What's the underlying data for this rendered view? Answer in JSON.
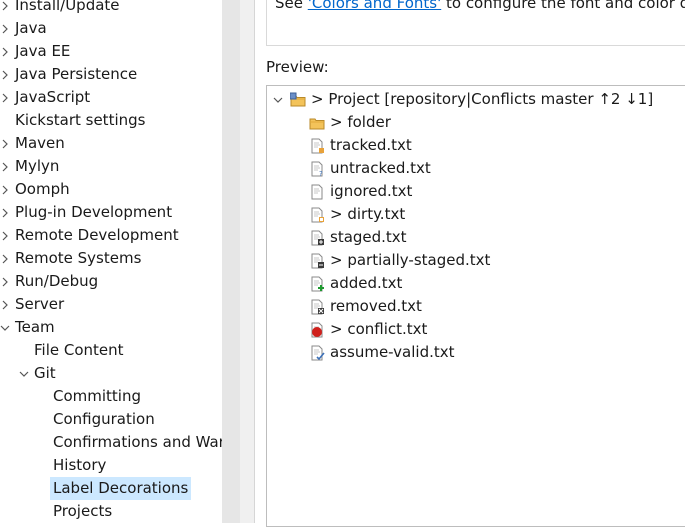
{
  "left_tree": {
    "items": [
      {
        "label": "Install/Update",
        "level": 0,
        "expander": "collapsed",
        "selected": false
      },
      {
        "label": "Java",
        "level": 0,
        "expander": "collapsed",
        "selected": false
      },
      {
        "label": "Java EE",
        "level": 0,
        "expander": "collapsed",
        "selected": false
      },
      {
        "label": "Java Persistence",
        "level": 0,
        "expander": "collapsed",
        "selected": false
      },
      {
        "label": "JavaScript",
        "level": 0,
        "expander": "collapsed",
        "selected": false
      },
      {
        "label": "Kickstart settings",
        "level": 0,
        "expander": "none",
        "selected": false
      },
      {
        "label": "Maven",
        "level": 0,
        "expander": "collapsed",
        "selected": false
      },
      {
        "label": "Mylyn",
        "level": 0,
        "expander": "collapsed",
        "selected": false
      },
      {
        "label": "Oomph",
        "level": 0,
        "expander": "collapsed",
        "selected": false
      },
      {
        "label": "Plug-in Development",
        "level": 0,
        "expander": "collapsed",
        "selected": false
      },
      {
        "label": "Remote Development",
        "level": 0,
        "expander": "collapsed",
        "selected": false
      },
      {
        "label": "Remote Systems",
        "level": 0,
        "expander": "collapsed",
        "selected": false
      },
      {
        "label": "Run/Debug",
        "level": 0,
        "expander": "collapsed",
        "selected": false
      },
      {
        "label": "Server",
        "level": 0,
        "expander": "collapsed",
        "selected": false
      },
      {
        "label": "Team",
        "level": 0,
        "expander": "expanded",
        "selected": false
      },
      {
        "label": "File Content",
        "level": 1,
        "expander": "none",
        "selected": false
      },
      {
        "label": "Git",
        "level": 1,
        "expander": "expanded",
        "selected": false
      },
      {
        "label": "Committing",
        "level": 2,
        "expander": "none",
        "selected": false
      },
      {
        "label": "Configuration",
        "level": 2,
        "expander": "none",
        "selected": false
      },
      {
        "label": "Confirmations and Warn",
        "level": 2,
        "expander": "none",
        "selected": false
      },
      {
        "label": "History",
        "level": 2,
        "expander": "none",
        "selected": false
      },
      {
        "label": "Label Decorations",
        "level": 2,
        "expander": "none",
        "selected": true
      },
      {
        "label": "Projects",
        "level": 2,
        "expander": "none",
        "selected": false
      }
    ]
  },
  "info": {
    "prefix": "See ",
    "link": "'Colors and Fonts'",
    "suffix": " to configure the font and color de"
  },
  "preview": {
    "label": "Preview:",
    "items": [
      {
        "name": "project",
        "text": "> Project  [repository|Conflicts master ↑2 ↓1]",
        "level": 0,
        "icon": "project-folder-icon",
        "expander": "expanded"
      },
      {
        "name": "folder",
        "text": "> folder",
        "level": 1,
        "icon": "folder-icon",
        "expander": "none"
      },
      {
        "name": "tracked",
        "text": "tracked.txt",
        "level": 1,
        "icon": "file-tracked-icon",
        "expander": "none"
      },
      {
        "name": "untracked",
        "text": "untracked.txt",
        "level": 1,
        "icon": "file-untracked-icon",
        "expander": "none"
      },
      {
        "name": "ignored",
        "text": "ignored.txt",
        "level": 1,
        "icon": "file-ignored-icon",
        "expander": "none"
      },
      {
        "name": "dirty",
        "text": "> dirty.txt",
        "level": 1,
        "icon": "file-dirty-icon",
        "expander": "none"
      },
      {
        "name": "staged",
        "text": "staged.txt",
        "level": 1,
        "icon": "file-staged-icon",
        "expander": "none"
      },
      {
        "name": "partially-staged",
        "text": "> partially-staged.txt",
        "level": 1,
        "icon": "file-partially-staged-icon",
        "expander": "none"
      },
      {
        "name": "added",
        "text": "added.txt",
        "level": 1,
        "icon": "file-added-icon",
        "expander": "none"
      },
      {
        "name": "removed",
        "text": "removed.txt",
        "level": 1,
        "icon": "file-removed-icon",
        "expander": "none"
      },
      {
        "name": "conflict",
        "text": "> conflict.txt",
        "level": 1,
        "icon": "file-conflict-icon",
        "expander": "none"
      },
      {
        "name": "assume-valid",
        "text": "assume-valid.txt",
        "level": 1,
        "icon": "file-assume-valid-icon",
        "expander": "none"
      }
    ]
  },
  "colors": {
    "selection": "#cce8ff",
    "link": "#0066cc",
    "scrollbar": "#e6e6e6",
    "border": "#bdbdbd"
  }
}
